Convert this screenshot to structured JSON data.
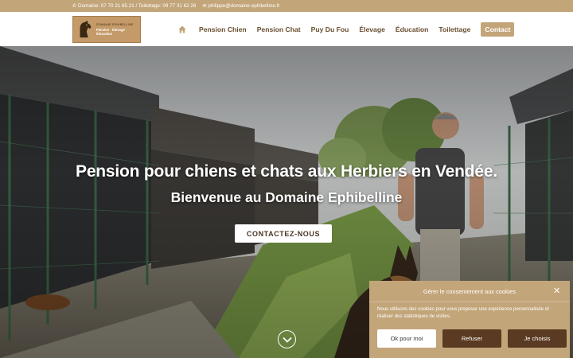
{
  "topbar": {
    "phone_text": "Domaine: 07 70 21 65 21 / Toilettage: 09 77 31 62 26",
    "email_text": "philippe@domaine-ephibelline.fr"
  },
  "logo": {
    "line1": "Domaine Ephibelline",
    "line2": "Pension · Élevage · Éducation"
  },
  "nav": {
    "items": [
      "Pension Chien",
      "Pension Chat",
      "Puy Du Fou",
      "Élevage",
      "Éducation",
      "Toilettage"
    ],
    "contact_label": "Contact"
  },
  "hero": {
    "title": "Pension pour chiens et chats aux Herbiers en Vendée.",
    "subtitle": "Bienvenue au Domaine Ephibelline",
    "cta_label": "CONTACTEZ-NOUS"
  },
  "cookie": {
    "title": "Gérer le consentement aux cookies",
    "body": "Nous utilisons des cookies pour vous proposer une expérience personnalisée et réaliser des statistiques de visites.",
    "accept_label": "Ok pour moi",
    "refuse_label": "Refuser",
    "choose_label": "Je choisis"
  },
  "colors": {
    "accent": "#c3a57a",
    "nav_text": "#6a4d2f",
    "dark_button": "#5a3a22"
  }
}
